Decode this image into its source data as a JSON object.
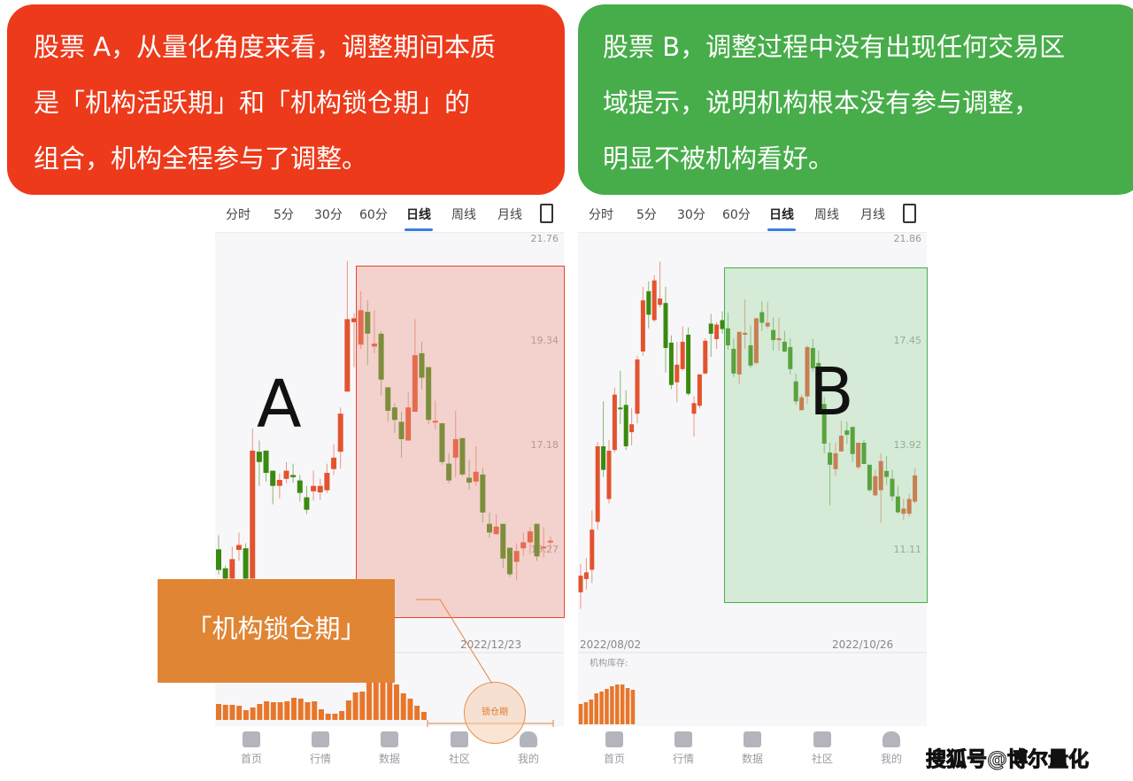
{
  "banners": {
    "left": {
      "color": "#ec3a1b",
      "lines": [
        "股票 A，从量化角度来看，调整期间本质",
        "是「机构活跃期」和「机构锁仓期」的",
        "组合，机构全程参与了调整。"
      ]
    },
    "right": {
      "color": "#47ad4a",
      "lines": [
        "股票 B，调整过程中没有出现任何交易区",
        "域提示，说明机构根本没有参与调整，",
        "明显不被机构看好。"
      ]
    }
  },
  "tabs": [
    "分时",
    "5分",
    "30分",
    "60分",
    "日线",
    "周线",
    "月线"
  ],
  "active_tab": "日线",
  "tab_icon": "rotate-screen-icon",
  "nav": [
    {
      "label": "首页",
      "icon": "home-icon"
    },
    {
      "label": "行情",
      "icon": "bar-chart-icon"
    },
    {
      "label": "数据",
      "icon": "monitor-chart-icon"
    },
    {
      "label": "社区",
      "icon": "message-icon"
    },
    {
      "label": "我的",
      "icon": "user-icon"
    }
  ],
  "colors": {
    "up": "#e2532e",
    "down": "#3a8a10",
    "accent": "#3c7de0",
    "inventory": "#e8762a"
  },
  "chartA": {
    "letter": "A",
    "y_ticks": [
      21.76,
      19.34,
      17.18,
      15.27
    ],
    "date_labels": [
      "2022/12/23"
    ],
    "candles": [
      [
        15.28,
        15.54,
        14.82,
        14.9
      ],
      [
        14.93,
        14.98,
        14.72,
        14.74
      ],
      [
        14.74,
        15.33,
        14.72,
        15.1
      ],
      [
        15.27,
        15.59,
        15.07,
        15.36
      ],
      [
        15.3,
        15.39,
        14.72,
        14.74
      ],
      [
        14.74,
        17.55,
        14.72,
        17.1
      ],
      [
        17.08,
        17.3,
        16.45,
        16.89
      ],
      [
        17.1,
        17.1,
        16.53,
        16.69
      ],
      [
        16.73,
        16.73,
        16.11,
        16.45
      ],
      [
        16.45,
        16.68,
        16.22,
        16.56
      ],
      [
        16.58,
        16.89,
        16.5,
        16.73
      ],
      [
        16.65,
        16.86,
        16.51,
        16.61
      ],
      [
        16.55,
        16.65,
        16.16,
        16.32
      ],
      [
        16.24,
        16.45,
        15.93,
        16.01
      ],
      [
        16.35,
        16.73,
        16.18,
        16.45
      ],
      [
        16.33,
        16.58,
        16.19,
        16.45
      ],
      [
        16.37,
        16.86,
        16.32,
        16.69
      ],
      [
        16.76,
        17.22,
        16.65,
        16.97
      ],
      [
        17.08,
        17.99,
        16.77,
        17.86
      ],
      [
        18.32,
        21.25,
        18.32,
        19.89
      ],
      [
        19.82,
        20.03,
        18.83,
        19.91
      ],
      [
        19.3,
        20.54,
        19.21,
        20.1
      ],
      [
        20.06,
        20.33,
        18.88,
        19.55
      ],
      [
        19.26,
        20.1,
        19.12,
        19.32
      ],
      [
        19.55,
        19.61,
        18.24,
        18.57
      ],
      [
        18.41,
        18.41,
        17.69,
        17.92
      ],
      [
        17.99,
        18.08,
        17.46,
        17.73
      ],
      [
        17.69,
        17.9,
        16.97,
        17.33
      ],
      [
        17.3,
        18.3,
        17.3,
        17.99
      ],
      [
        17.9,
        19.89,
        17.9,
        19.08
      ],
      [
        19.12,
        19.36,
        18.37,
        18.61
      ],
      [
        18.83,
        18.83,
        17.64,
        17.73
      ],
      [
        17.69,
        18.13,
        17.53,
        17.71
      ],
      [
        17.66,
        17.66,
        16.84,
        16.89
      ],
      [
        16.86,
        17.05,
        16.5,
        16.55
      ],
      [
        16.97,
        17.92,
        16.61,
        17.33
      ],
      [
        17.35,
        17.35,
        16.63,
        16.66
      ],
      [
        16.6,
        16.93,
        16.38,
        16.51
      ],
      [
        16.53,
        17.18,
        16.45,
        16.71
      ],
      [
        16.66,
        16.79,
        15.77,
        15.96
      ],
      [
        15.75,
        15.96,
        15.49,
        15.59
      ],
      [
        15.56,
        15.93,
        15.56,
        15.7
      ],
      [
        15.75,
        15.75,
        14.94,
        15.11
      ],
      [
        15.31,
        15.31,
        14.77,
        14.82
      ],
      [
        15.05,
        15.39,
        14.71,
        15.25
      ],
      [
        15.3,
        15.58,
        15.16,
        15.41
      ],
      [
        15.41,
        15.69,
        15.19,
        15.61
      ],
      [
        15.75,
        15.75,
        15.07,
        15.15
      ],
      [
        15.31,
        15.69,
        15.13,
        15.33
      ],
      [
        15.43,
        15.52,
        15.28,
        15.44
      ]
    ],
    "inventory": [
      18,
      17,
      17,
      16,
      11,
      14,
      18,
      21,
      20,
      20,
      21,
      25,
      24,
      20,
      21,
      12,
      7,
      7,
      10,
      22,
      31,
      32,
      46,
      50,
      48,
      44,
      40,
      30,
      24,
      16,
      9
    ],
    "callout": "「机构锁仓期」",
    "lock_label": "锁仓期"
  },
  "chartB": {
    "letter": "B",
    "y_ticks": [
      21.86,
      17.45,
      13.92,
      11.11
    ],
    "date_labels": [
      "2022/08/02",
      "2022/10/26"
    ],
    "inventory_label": "机构库存:",
    "candles": [
      [
        9.96,
        10.73,
        9.51,
        10.41
      ],
      [
        10.32,
        10.89,
        10.03,
        10.5
      ],
      [
        10.57,
        12.18,
        10.21,
        11.66
      ],
      [
        11.87,
        14.07,
        11.66,
        13.92
      ],
      [
        13.92,
        15.45,
        13.09,
        13.28
      ],
      [
        12.49,
        14.13,
        12.37,
        13.8
      ],
      [
        13.82,
        15.92,
        13.75,
        15.68
      ],
      [
        15.24,
        16.49,
        14.67,
        15.18
      ],
      [
        15.33,
        15.83,
        13.82,
        13.92
      ],
      [
        14.4,
        15.21,
        13.95,
        14.67
      ],
      [
        15.03,
        17.0,
        14.7,
        16.88
      ],
      [
        17.15,
        19.83,
        17.0,
        19.25
      ],
      [
        19.64,
        20.06,
        18.06,
        18.64
      ],
      [
        18.41,
        20.33,
        18.33,
        20.1
      ],
      [
        19.06,
        20.9,
        18.95,
        19.33
      ],
      [
        19.14,
        19.83,
        16.43,
        17.27
      ],
      [
        17.45,
        17.76,
        15.86,
        16.01
      ],
      [
        16.1,
        17.49,
        15.42,
        16.7
      ],
      [
        16.55,
        18.14,
        16.49,
        17.49
      ],
      [
        17.79,
        18.1,
        15.65,
        15.71
      ],
      [
        15.03,
        15.62,
        14.25,
        15.39
      ],
      [
        15.3,
        16.37,
        15.21,
        16.37
      ],
      [
        16.4,
        17.64,
        16.37,
        17.53
      ],
      [
        18.26,
        18.68,
        16.97,
        17.83
      ],
      [
        17.6,
        18.33,
        17.24,
        18.22
      ],
      [
        18.41,
        18.79,
        17.83,
        18.03
      ],
      [
        18.06,
        18.72,
        17.21,
        17.36
      ],
      [
        17.24,
        17.64,
        16.28,
        16.4
      ],
      [
        16.37,
        17.91,
        16.04,
        17.91
      ],
      [
        17.79,
        19.29,
        17.24,
        17.87
      ],
      [
        17.36,
        18.18,
        16.58,
        16.67
      ],
      [
        16.76,
        18.49,
        16.7,
        18.49
      ],
      [
        18.75,
        19.21,
        17.95,
        18.3
      ],
      [
        18.14,
        19.18,
        18.06,
        18.3
      ],
      [
        17.99,
        18.52,
        17.18,
        17.56
      ],
      [
        17.56,
        18.52,
        17.18,
        17.64
      ],
      [
        17.49,
        17.95,
        17.12,
        17.15
      ],
      [
        17.3,
        17.64,
        16.37,
        16.55
      ],
      [
        16.13,
        16.4,
        15.33,
        15.45
      ],
      [
        15.15,
        15.68,
        15.15,
        15.59
      ],
      [
        15.62,
        17.36,
        15.36,
        17.3
      ],
      [
        17.27,
        17.6,
        16.46,
        16.58
      ],
      [
        16.76,
        17.18,
        15.5,
        15.74
      ],
      [
        15.36,
        15.59,
        13.73,
        14.01
      ],
      [
        13.75,
        14.04,
        12.32,
        13.42
      ],
      [
        13.3,
        14.04,
        13.11,
        13.73
      ],
      [
        13.78,
        14.79,
        13.78,
        14.28
      ],
      [
        14.46,
        14.76,
        14.01,
        14.31
      ],
      [
        14.58,
        14.58,
        13.49,
        13.71
      ],
      [
        13.35,
        14.04,
        13.3,
        14.04
      ],
      [
        14.04,
        14.13,
        13.44,
        13.44
      ],
      [
        13.42,
        13.42,
        12.68,
        12.73
      ],
      [
        12.59,
        13.28,
        12.56,
        13.11
      ],
      [
        12.73,
        13.73,
        11.85,
        13.52
      ],
      [
        13.25,
        13.66,
        12.87,
        13.09
      ],
      [
        13.04,
        13.28,
        12.44,
        12.56
      ],
      [
        12.56,
        12.85,
        12.09,
        12.13
      ],
      [
        12.09,
        12.49,
        11.92,
        12.23
      ],
      [
        12.09,
        12.63,
        12.01,
        12.49
      ],
      [
        12.42,
        13.32,
        12.37,
        13.13
      ]
    ],
    "inventory": [
      23,
      25,
      28,
      35,
      37,
      40,
      43,
      45,
      45,
      41,
      39
    ]
  },
  "watermark": "搜狐号@博尔量化"
}
